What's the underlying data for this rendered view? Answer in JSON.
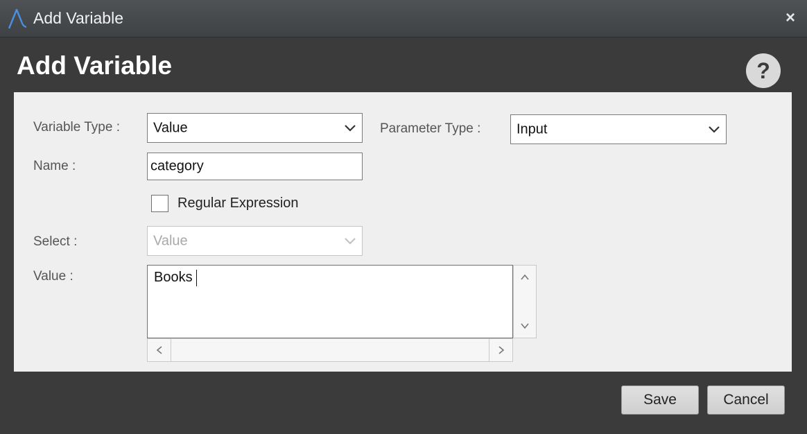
{
  "window": {
    "title": "Add Variable",
    "close_glyph": "×"
  },
  "dialog": {
    "heading": "Add Variable",
    "help_glyph": "?"
  },
  "form": {
    "variable_type": {
      "label": "Variable Type :",
      "value": "Value"
    },
    "parameter_type": {
      "label": "Parameter Type :",
      "value": "Input"
    },
    "name": {
      "label": "Name :",
      "value": "category"
    },
    "regular_expression": {
      "label": "Regular Expression",
      "checked": false
    },
    "select": {
      "label": "Select :",
      "value": "Value",
      "disabled": true
    },
    "value": {
      "label": "Value :",
      "text": "Books"
    }
  },
  "buttons": {
    "save": "Save",
    "cancel": "Cancel"
  },
  "icons": {
    "app_logo": "app-logo-icon",
    "close": "close-icon",
    "help": "help-icon",
    "dropdown": "chevron-down-icon",
    "scroll_up": "chevron-up-icon",
    "scroll_down": "chevron-down-icon",
    "scroll_left": "chevron-left-icon",
    "scroll_right": "chevron-right-icon"
  },
  "colors": {
    "window_bg": "#3b3b3b",
    "panel_bg": "#efefef",
    "logo_accent": "#4a90e2"
  }
}
